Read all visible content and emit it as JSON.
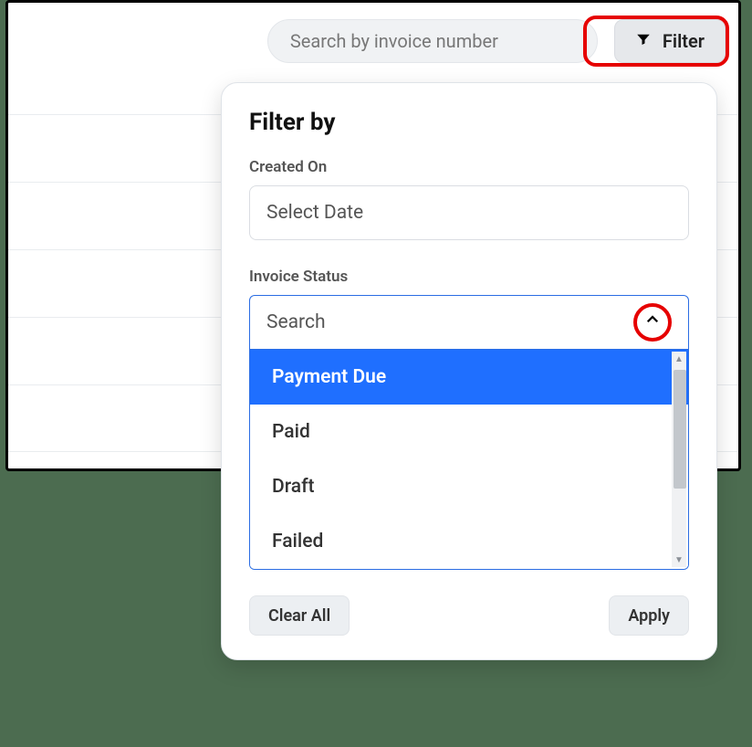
{
  "toolbar": {
    "search_placeholder": "Search by invoice number",
    "filter_label": "Filter"
  },
  "filter_panel": {
    "title": "Filter by",
    "created_on_label": "Created On",
    "created_on_placeholder": "Select Date",
    "invoice_status_label": "Invoice Status",
    "status_search_placeholder": "Search",
    "status_options": [
      "Payment Due",
      "Paid",
      "Draft",
      "Failed"
    ],
    "status_selected_index": 0,
    "clear_all_label": "Clear All",
    "apply_label": "Apply"
  },
  "highlights": {
    "filter_button": "#e60000",
    "chevron": "#e60000"
  }
}
